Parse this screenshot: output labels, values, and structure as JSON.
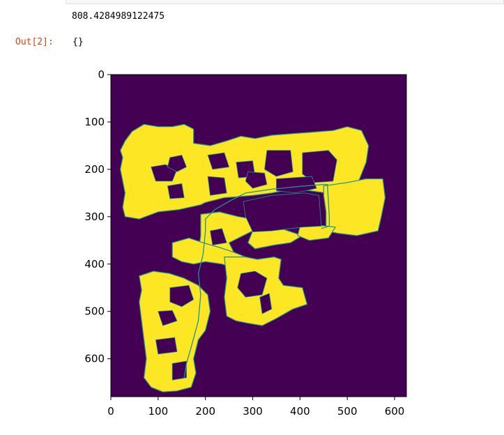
{
  "notebook": {
    "stdout_text": "808.4284989122475",
    "out_prompt": "Out[2]:",
    "out_value": "{}"
  },
  "chart_data": {
    "type": "heatmap",
    "title": "",
    "xlabel": "",
    "ylabel": "",
    "xlim": [
      0,
      625
    ],
    "ylim": [
      680,
      0
    ],
    "x_ticks": [
      0,
      100,
      200,
      300,
      400,
      500,
      600
    ],
    "y_ticks": [
      0,
      100,
      200,
      300,
      400,
      500,
      600
    ],
    "colormap": "viridis",
    "colors": {
      "background": "#440154",
      "free_space": "#fde725",
      "path": "#21918c"
    },
    "path": [
      [
        155,
        640
      ],
      [
        160,
        610
      ],
      [
        170,
        575
      ],
      [
        185,
        520
      ],
      [
        190,
        465
      ],
      [
        185,
        420
      ],
      [
        195,
        380
      ],
      [
        200,
        330
      ],
      [
        200,
        305
      ],
      [
        220,
        285
      ],
      [
        255,
        265
      ],
      [
        285,
        250
      ],
      [
        340,
        242
      ],
      [
        400,
        236
      ],
      [
        450,
        232
      ],
      [
        458,
        232
      ],
      [
        462,
        300
      ],
      [
        462,
        320
      ],
      [
        445,
        325
      ]
    ],
    "free_regions": [
      [
        [
          30,
          140
        ],
        [
          45,
          120
        ],
        [
          70,
          105
        ],
        [
          100,
          110
        ],
        [
          130,
          110
        ],
        [
          155,
          105
        ],
        [
          175,
          115
        ],
        [
          175,
          145
        ],
        [
          210,
          150
        ],
        [
          245,
          140
        ],
        [
          275,
          130
        ],
        [
          305,
          135
        ],
        [
          340,
          128
        ],
        [
          380,
          125
        ],
        [
          420,
          122
        ],
        [
          470,
          118
        ],
        [
          500,
          110
        ],
        [
          530,
          118
        ],
        [
          545,
          150
        ],
        [
          540,
          185
        ],
        [
          528,
          215
        ],
        [
          518,
          240
        ],
        [
          485,
          252
        ],
        [
          470,
          252
        ],
        [
          420,
          245
        ],
        [
          380,
          242
        ],
        [
          340,
          250
        ],
        [
          300,
          255
        ],
        [
          265,
          258
        ],
        [
          240,
          260
        ],
        [
          200,
          270
        ],
        [
          190,
          275
        ],
        [
          145,
          285
        ],
        [
          100,
          290
        ],
        [
          60,
          305
        ],
        [
          30,
          300
        ],
        [
          25,
          280
        ],
        [
          30,
          250
        ],
        [
          25,
          225
        ],
        [
          20,
          200
        ],
        [
          25,
          175
        ],
        [
          20,
          160
        ]
      ],
      [
        [
          450,
          235
        ],
        [
          500,
          228
        ],
        [
          540,
          220
        ],
        [
          575,
          220
        ],
        [
          580,
          260
        ],
        [
          572,
          300
        ],
        [
          565,
          330
        ],
        [
          520,
          340
        ],
        [
          480,
          335
        ],
        [
          455,
          330
        ],
        [
          455,
          290
        ],
        [
          450,
          255
        ]
      ],
      [
        [
          190,
          295
        ],
        [
          230,
          290
        ],
        [
          270,
          300
        ],
        [
          300,
          305
        ],
        [
          300,
          330
        ],
        [
          270,
          345
        ],
        [
          250,
          355
        ],
        [
          260,
          375
        ],
        [
          220,
          380
        ],
        [
          185,
          375
        ],
        [
          190,
          340
        ]
      ],
      [
        [
          300,
          330
        ],
        [
          360,
          325
        ],
        [
          405,
          340
        ],
        [
          380,
          355
        ],
        [
          345,
          360
        ],
        [
          305,
          368
        ],
        [
          290,
          355
        ]
      ],
      [
        [
          400,
          320
        ],
        [
          440,
          318
        ],
        [
          475,
          322
        ],
        [
          460,
          345
        ],
        [
          420,
          350
        ],
        [
          395,
          340
        ]
      ],
      [
        [
          130,
          355
        ],
        [
          165,
          345
        ],
        [
          195,
          355
        ],
        [
          230,
          365
        ],
        [
          260,
          375
        ],
        [
          285,
          385
        ],
        [
          280,
          400
        ],
        [
          265,
          410
        ],
        [
          235,
          400
        ],
        [
          200,
          395
        ],
        [
          175,
          400
        ],
        [
          150,
          395
        ],
        [
          130,
          385
        ]
      ],
      [
        [
          240,
          385
        ],
        [
          285,
          385
        ],
        [
          310,
          390
        ],
        [
          345,
          385
        ],
        [
          360,
          390
        ],
        [
          355,
          430
        ],
        [
          365,
          445
        ],
        [
          405,
          450
        ],
        [
          415,
          485
        ],
        [
          385,
          495
        ],
        [
          350,
          515
        ],
        [
          320,
          530
        ],
        [
          290,
          525
        ],
        [
          265,
          520
        ],
        [
          245,
          510
        ],
        [
          240,
          470
        ],
        [
          245,
          430
        ]
      ],
      [
        [
          60,
          425
        ],
        [
          90,
          415
        ],
        [
          125,
          420
        ],
        [
          155,
          430
        ],
        [
          185,
          445
        ],
        [
          205,
          465
        ],
        [
          210,
          500
        ],
        [
          200,
          540
        ],
        [
          185,
          560
        ],
        [
          175,
          600
        ],
        [
          180,
          630
        ],
        [
          170,
          660
        ],
        [
          140,
          668
        ],
        [
          110,
          670
        ],
        [
          85,
          660
        ],
        [
          70,
          640
        ],
        [
          75,
          600
        ],
        [
          70,
          560
        ],
        [
          65,
          520
        ],
        [
          60,
          480
        ],
        [
          65,
          455
        ]
      ]
    ],
    "obstacle_holes": [
      [
        [
          85,
          195
        ],
        [
          115,
          190
        ],
        [
          140,
          200
        ],
        [
          130,
          225
        ],
        [
          95,
          225
        ]
      ],
      [
        [
          125,
          175
        ],
        [
          150,
          170
        ],
        [
          160,
          195
        ],
        [
          140,
          205
        ],
        [
          120,
          195
        ]
      ],
      [
        [
          330,
          160
        ],
        [
          380,
          160
        ],
        [
          385,
          205
        ],
        [
          350,
          215
        ],
        [
          325,
          200
        ]
      ],
      [
        [
          265,
          185
        ],
        [
          300,
          182
        ],
        [
          305,
          215
        ],
        [
          270,
          218
        ]
      ],
      [
        [
          405,
          165
        ],
        [
          460,
          160
        ],
        [
          478,
          180
        ],
        [
          470,
          225
        ],
        [
          430,
          228
        ],
        [
          405,
          210
        ]
      ],
      [
        [
          350,
          220
        ],
        [
          425,
          215
        ],
        [
          435,
          240
        ],
        [
          390,
          250
        ],
        [
          350,
          245
        ]
      ],
      [
        [
          205,
          170
        ],
        [
          240,
          165
        ],
        [
          250,
          195
        ],
        [
          215,
          200
        ]
      ],
      [
        [
          205,
          215
        ],
        [
          240,
          218
        ],
        [
          245,
          250
        ],
        [
          210,
          255
        ]
      ],
      [
        [
          120,
          235
        ],
        [
          150,
          230
        ],
        [
          155,
          260
        ],
        [
          125,
          262
        ]
      ],
      [
        [
          290,
          205
        ],
        [
          325,
          208
        ],
        [
          330,
          232
        ],
        [
          300,
          240
        ],
        [
          285,
          225
        ]
      ],
      [
        [
          280,
          268
        ],
        [
          340,
          255
        ],
        [
          410,
          250
        ],
        [
          440,
          255
        ],
        [
          445,
          320
        ],
        [
          405,
          322
        ],
        [
          340,
          330
        ],
        [
          300,
          332
        ],
        [
          285,
          300
        ]
      ],
      [
        [
          125,
          450
        ],
        [
          165,
          445
        ],
        [
          175,
          475
        ],
        [
          150,
          490
        ],
        [
          125,
          480
        ]
      ],
      [
        [
          100,
          500
        ],
        [
          130,
          498
        ],
        [
          140,
          520
        ],
        [
          110,
          530
        ]
      ],
      [
        [
          275,
          420
        ],
        [
          305,
          415
        ],
        [
          330,
          430
        ],
        [
          320,
          465
        ],
        [
          285,
          470
        ],
        [
          268,
          450
        ]
      ],
      [
        [
          315,
          470
        ],
        [
          335,
          462
        ],
        [
          340,
          495
        ],
        [
          320,
          505
        ]
      ],
      [
        [
          95,
          560
        ],
        [
          135,
          555
        ],
        [
          140,
          585
        ],
        [
          100,
          590
        ]
      ],
      [
        [
          130,
          610
        ],
        [
          160,
          605
        ],
        [
          160,
          640
        ],
        [
          130,
          645
        ]
      ],
      [
        [
          210,
          330
        ],
        [
          235,
          325
        ],
        [
          245,
          355
        ],
        [
          215,
          360
        ]
      ]
    ]
  }
}
